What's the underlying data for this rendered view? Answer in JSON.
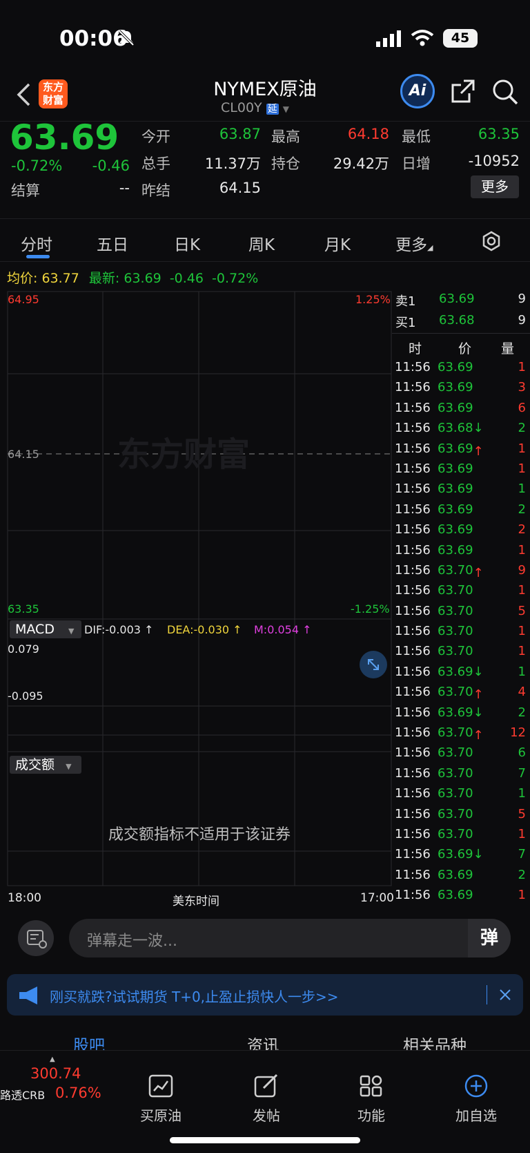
{
  "status_bar": {
    "time": "00:06",
    "battery": "45"
  },
  "header": {
    "title": "NYMEX原油",
    "code": "CL00Y",
    "delay_badge": "延",
    "logo_line1": "东方",
    "logo_line2": "财富",
    "ai_label": "Ai"
  },
  "quote": {
    "price": "63.69",
    "change_pct": "-0.72%",
    "change": "-0.46",
    "settle_label": "结算",
    "settle_value": "--",
    "items": [
      {
        "label": "今开",
        "value": "63.87",
        "color": "green"
      },
      {
        "label": "最高",
        "value": "64.18",
        "color": "red"
      },
      {
        "label": "最低",
        "value": "63.35",
        "color": "green"
      },
      {
        "label": "总手",
        "value": "11.37万",
        "color": "white"
      },
      {
        "label": "持仓",
        "value": "29.42万",
        "color": "white"
      },
      {
        "label": "日增",
        "value": "-10952",
        "color": "white"
      },
      {
        "label": "昨结",
        "value": "64.15",
        "color": "white"
      }
    ],
    "more_button": "更多"
  },
  "tabs": [
    "分时",
    "五日",
    "日K",
    "周K",
    "月K",
    "更多"
  ],
  "active_tab": "分时",
  "avg_bar": {
    "avg_label": "均价:",
    "avg_value": "63.77",
    "latest_label": "最新:",
    "latest_value": "63.69",
    "change": "-0.46",
    "change_pct": "-0.72%"
  },
  "chart": {
    "price_high": "64.95",
    "price_mid": "64.15",
    "price_low": "63.35",
    "pct_high": "1.25%",
    "pct_low": "-1.25%",
    "macd_label": "MACD",
    "dif": "DIF:-0.003 ↑",
    "dea": "DEA:-0.030 ↑",
    "m": "M:0.054 ↑",
    "macd_high": "0.079",
    "macd_low": "-0.095",
    "volume_label": "成交额",
    "volume_note": "成交额指标不适用于该证券",
    "time_start": "18:00",
    "time_mid": "美东时间",
    "time_end": "17:00",
    "watermark": "东方财富"
  },
  "orderbook": {
    "sell_label": "卖1",
    "sell_price": "63.69",
    "sell_qty": "9",
    "buy_label": "买1",
    "buy_price": "63.68",
    "buy_qty": "9",
    "col_time": "时",
    "col_price": "价",
    "col_qty": "量"
  },
  "ticks": [
    {
      "t": "11:56",
      "p": "63.69",
      "q": "1",
      "qc": "r",
      "a": ""
    },
    {
      "t": "11:56",
      "p": "63.69",
      "q": "3",
      "qc": "r",
      "a": ""
    },
    {
      "t": "11:56",
      "p": "63.69",
      "q": "6",
      "qc": "r",
      "a": ""
    },
    {
      "t": "11:56",
      "p": "63.68↓",
      "q": "2",
      "qc": "g",
      "a": ""
    },
    {
      "t": "11:56",
      "p": "63.69↑",
      "q": "1",
      "qc": "r",
      "a": ""
    },
    {
      "t": "11:56",
      "p": "63.69",
      "q": "1",
      "qc": "r",
      "a": ""
    },
    {
      "t": "11:56",
      "p": "63.69",
      "q": "1",
      "qc": "g",
      "a": ""
    },
    {
      "t": "11:56",
      "p": "63.69",
      "q": "2",
      "qc": "g",
      "a": ""
    },
    {
      "t": "11:56",
      "p": "63.69",
      "q": "2",
      "qc": "r",
      "a": ""
    },
    {
      "t": "11:56",
      "p": "63.69",
      "q": "1",
      "qc": "r",
      "a": ""
    },
    {
      "t": "11:56",
      "p": "63.70↑",
      "q": "9",
      "qc": "r",
      "a": ""
    },
    {
      "t": "11:56",
      "p": "63.70",
      "q": "1",
      "qc": "r",
      "a": ""
    },
    {
      "t": "11:56",
      "p": "63.70",
      "q": "5",
      "qc": "r",
      "a": ""
    },
    {
      "t": "11:56",
      "p": "63.70",
      "q": "1",
      "qc": "r",
      "a": ""
    },
    {
      "t": "11:56",
      "p": "63.70",
      "q": "1",
      "qc": "r",
      "a": ""
    },
    {
      "t": "11:56",
      "p": "63.69↓",
      "q": "1",
      "qc": "g",
      "a": ""
    },
    {
      "t": "11:56",
      "p": "63.70↑",
      "q": "4",
      "qc": "r",
      "a": ""
    },
    {
      "t": "11:56",
      "p": "63.69↓",
      "q": "2",
      "qc": "g",
      "a": ""
    },
    {
      "t": "11:56",
      "p": "63.70↑",
      "q": "12",
      "qc": "r",
      "a": ""
    },
    {
      "t": "11:56",
      "p": "63.70",
      "q": "6",
      "qc": "g",
      "a": ""
    },
    {
      "t": "11:56",
      "p": "63.70",
      "q": "7",
      "qc": "g",
      "a": ""
    },
    {
      "t": "11:56",
      "p": "63.70",
      "q": "1",
      "qc": "g",
      "a": ""
    },
    {
      "t": "11:56",
      "p": "63.70",
      "q": "5",
      "qc": "r",
      "a": ""
    },
    {
      "t": "11:56",
      "p": "63.70",
      "q": "1",
      "qc": "r",
      "a": ""
    },
    {
      "t": "11:56",
      "p": "63.69↓",
      "q": "7",
      "qc": "g",
      "a": ""
    },
    {
      "t": "11:56",
      "p": "63.69",
      "q": "2",
      "qc": "g",
      "a": ""
    },
    {
      "t": "11:56",
      "p": "63.69",
      "q": "1",
      "qc": "r",
      "a": ""
    }
  ],
  "danmu": {
    "placeholder": "弹幕走一波...",
    "send_icon_label": "弹"
  },
  "ad": {
    "text": "刚买就跌?试试期货 T+0,止盈止损快人一步>>"
  },
  "subtabs": [
    "股吧",
    "资讯",
    "相关品种"
  ],
  "bottom": {
    "index_value": "300.74",
    "index_name": "路透CRB",
    "index_pct": "0.76%",
    "items": [
      {
        "label": "买原油",
        "icon": "chart-icon"
      },
      {
        "label": "发帖",
        "icon": "edit-icon"
      },
      {
        "label": "功能",
        "icon": "grid-icon"
      },
      {
        "label": "加自选",
        "icon": "plus-circle-icon"
      }
    ]
  }
}
